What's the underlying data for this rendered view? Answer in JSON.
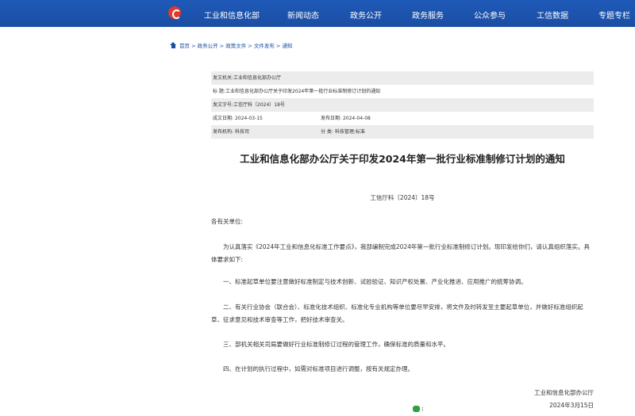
{
  "nav": {
    "items": [
      "工业和信息化部",
      "新闻动态",
      "政务公开",
      "政务服务",
      "公众参与",
      "工信数据",
      "专题专栏"
    ]
  },
  "breadcrumb": [
    "首页",
    "政务公开",
    "政策文件",
    "文件发布",
    "通知"
  ],
  "breadcrumb_sep": ">",
  "meta": {
    "issuer_label": "发文机关:",
    "issuer": "工业和信息化部办公厅",
    "title_label": "标    题:",
    "title": "工业和信息化部办公厅关于印发2024年第一批行业标准制修订计划的通知",
    "docno_label": "发文字号:",
    "docno": "工信厅科〔2024〕18号",
    "date_label": "成文日期:",
    "date": "2024-03-15",
    "pub_label": "发布日期:",
    "pub": "2024-04-08",
    "org_label": "发布机构:",
    "org": "科技司",
    "cat_label": "分    类:",
    "cat": "科技管理;标准"
  },
  "doc": {
    "title": "工业和信息化部办公厅关于印发2024年第一批行业标准制修订计划的通知",
    "number": "工信厅科〔2024〕18号",
    "greeting": "各有关单位:",
    "p1": "为认真落实《2024年工业和信息化标准工作要点》，我部编制完成2024年第一批行业标准制修订计划。现印发给你们，请认真组织落实。具体要求如下:",
    "p2": "一、标准起草单位要注意做好标准制定与技术创新、试验验证、知识产权处置、产业化推进、应用推广的统筹协调。",
    "p3": "二、有关行业协会（联合会）、标准化技术组织、标准化专业机构等单位要尽早安排，将文件及时转发至主要起草单位，并做好标准组织起草、征求意见和技术审查等工作，把好技术审查关。",
    "p4": "三、部机关相关司局要做好行业标准制修订过程的管理工作，确保标准的质量和水平。",
    "p5": "四、在计划的执行过程中，如需对标准项目进行调整，按有关规定办理。",
    "sign": "工业和信息化部办公厅",
    "date": "2024年3月15日"
  }
}
